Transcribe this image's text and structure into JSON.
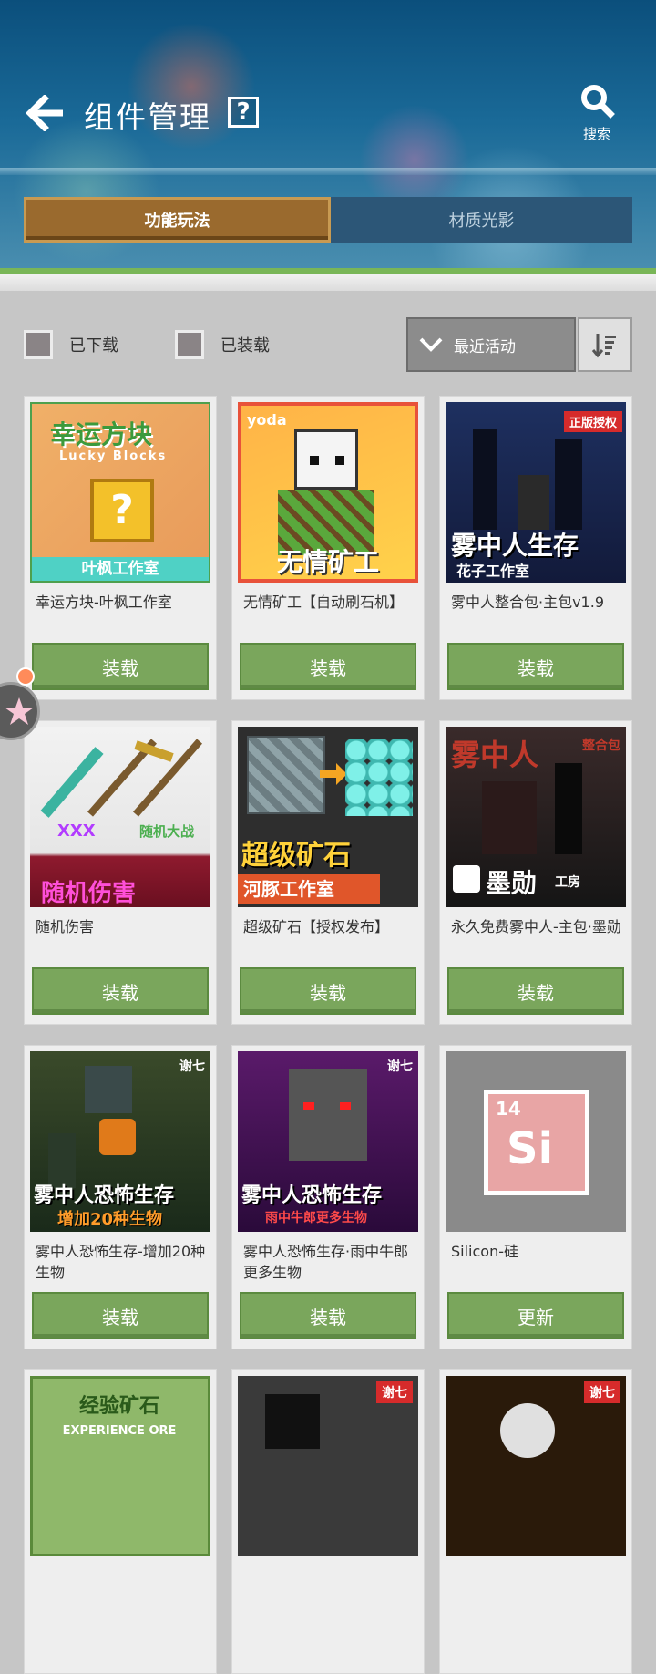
{
  "header": {
    "title": "组件管理",
    "help_label": "?",
    "search_label": "搜索"
  },
  "tabs": [
    {
      "label": "功能玩法",
      "active": true
    },
    {
      "label": "材质光影",
      "active": false
    }
  ],
  "filters": {
    "downloaded_label": "已下载",
    "installed_label": "已装载",
    "sort_label": "最近活动"
  },
  "items": [
    {
      "title": "幸运方块-叶枫工作室",
      "button": "装载",
      "thumb_text": [
        "幸运方块",
        "Lucky Blocks",
        "叶枫工作室"
      ],
      "thumb_icon": "lucky-block-icon"
    },
    {
      "title": "无情矿工【自动刷石机】",
      "button": "装载",
      "thumb_text": [
        "yoda",
        "无情矿工"
      ],
      "thumb_icon": "miner-icon"
    },
    {
      "title": "雾中人整合包·主包v1.9",
      "button": "装载",
      "thumb_text": [
        "正版授权",
        "雾中人生存",
        "花子工作室"
      ],
      "thumb_icon": "fog-man-icon"
    },
    {
      "title": "随机伤害",
      "button": "装载",
      "thumb_text": [
        "XXX",
        "随机大战",
        "随机伤害"
      ],
      "thumb_icon": "weapons-icon"
    },
    {
      "title": "超级矿石【授权发布】",
      "button": "装载",
      "thumb_text": [
        "超级矿石",
        "河豚工作室"
      ],
      "thumb_icon": "diamond-ore-icon"
    },
    {
      "title": "永久免费雾中人-主包·墨勋",
      "button": "装载",
      "thumb_text": [
        "雾中人",
        "整合包",
        "墨勋",
        "工房"
      ],
      "thumb_icon": "fog-man-icon"
    },
    {
      "title": "雾中人恐怖生存-增加20种生物",
      "button": "装载",
      "thumb_text": [
        "谢七",
        "雾中人恐怖生存",
        "增加20种生物"
      ],
      "thumb_icon": "horror-mob-icon"
    },
    {
      "title": "雾中人恐怖生存·雨中牛郎更多生物",
      "button": "装载",
      "thumb_text": [
        "谢七",
        "雾中人恐怖生存",
        "雨中牛郎更多生物"
      ],
      "thumb_icon": "horror-mob-icon"
    },
    {
      "title": "Silicon-硅",
      "button": "更新",
      "thumb_text": [
        "14",
        "Si"
      ],
      "thumb_icon": "silicon-block-icon"
    },
    {
      "title": "",
      "button": "",
      "thumb_text": [
        "经验矿石",
        "EXPERIENCE ORE"
      ],
      "thumb_icon": "experience-ore-icon"
    },
    {
      "title": "",
      "button": "",
      "thumb_text": [
        "谢七"
      ],
      "thumb_icon": "horror-mob-icon"
    },
    {
      "title": "",
      "button": "",
      "thumb_text": [
        "谢七"
      ],
      "thumb_icon": "horror-mob-icon"
    }
  ],
  "colors": {
    "install_button": "#7aa65c",
    "active_tab": "#9a6a2e",
    "inactive_tab": "#2c5677",
    "accent_green": "#79b657"
  }
}
